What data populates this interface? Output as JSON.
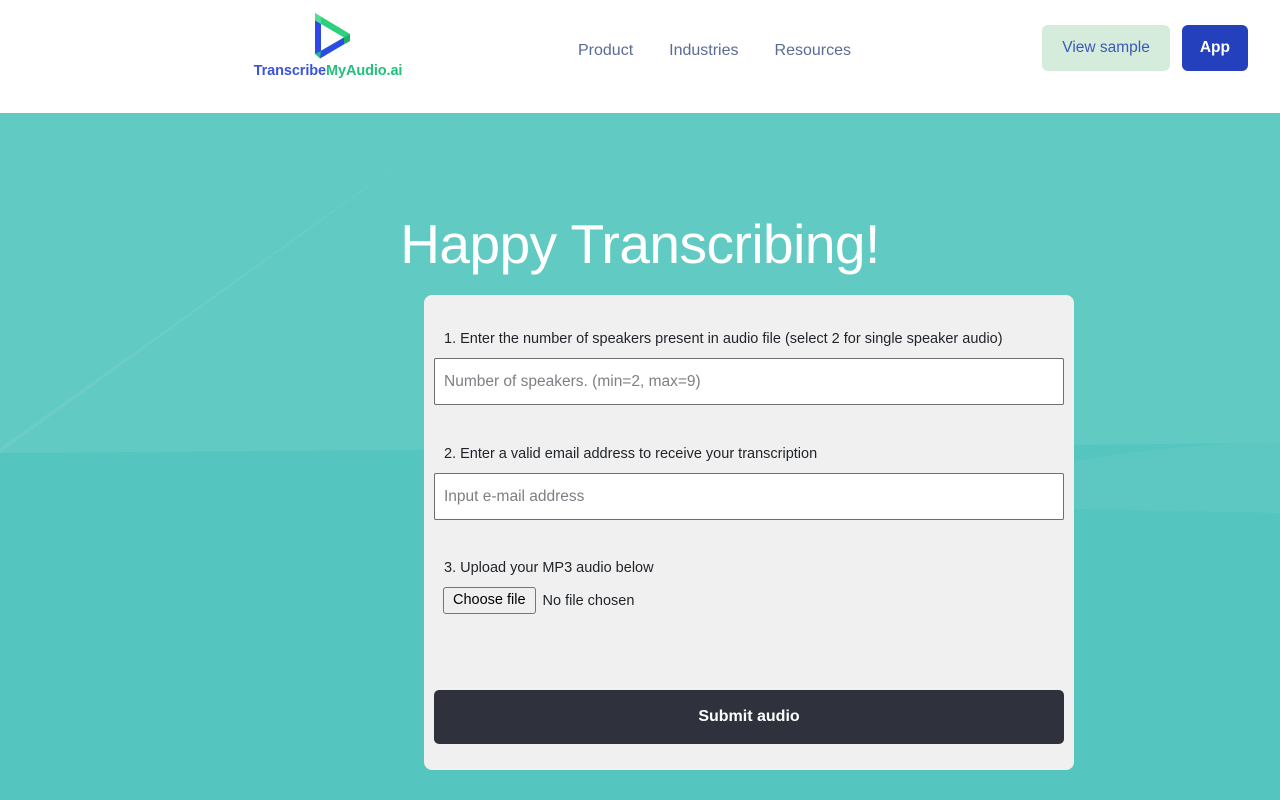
{
  "header": {
    "brand": {
      "logo_icon": "penrose-triangle-play-logo",
      "name_part1": "Transcribe",
      "name_part2": "MyAudio.ai",
      "color_part1": "#3b55d9",
      "color_part2": "#22c07a"
    },
    "nav": [
      {
        "label": "Product"
      },
      {
        "label": "Industries"
      },
      {
        "label": "Resources"
      }
    ],
    "actions": {
      "view_sample_label": "View sample",
      "view_sample_bg": "#d5ecdc",
      "view_sample_color": "#3a5ab4",
      "app_label": "App",
      "app_bg": "#2540bc",
      "app_color": "#ffffff"
    }
  },
  "hero": {
    "title": "Happy Transcribing!",
    "background_color": "#55c6bf",
    "title_color": "#ffffff"
  },
  "form": {
    "step1": {
      "label": "1. Enter the number of speakers present in audio file (select 2 for single speaker audio)",
      "placeholder": "Number of speakers. (min=2, max=9)",
      "value": ""
    },
    "step2": {
      "label": "2. Enter a valid email address to receive your transcription",
      "placeholder": "Input e-mail address",
      "value": ""
    },
    "step3": {
      "label": "3. Upload your MP3 audio below",
      "choose_file_label": "Choose file",
      "file_status": "No file chosen"
    },
    "submit_label": "Submit audio",
    "submit_bg": "#2f323d",
    "card_bg": "#f0f0f0"
  }
}
